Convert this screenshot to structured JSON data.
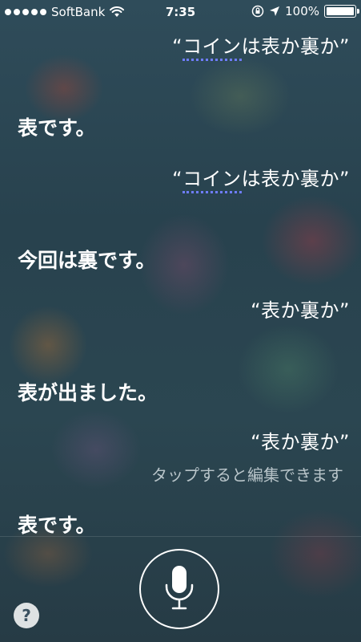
{
  "status_bar": {
    "carrier": "SoftBank",
    "time": "7:35",
    "battery": "100%"
  },
  "conversation": [
    {
      "type": "user",
      "pre": "“",
      "underlined": "コイン",
      "post": "は表か裏か”"
    },
    {
      "type": "siri",
      "text": "表です。"
    },
    {
      "type": "user",
      "pre": "“",
      "underlined": "コイン",
      "post": "は表か裏か”"
    },
    {
      "type": "siri",
      "text": "今回は裏です。"
    },
    {
      "type": "user",
      "pre": "",
      "underlined": "",
      "post": "“表か裏か”"
    },
    {
      "type": "siri",
      "text": "表が出ました。"
    },
    {
      "type": "user",
      "pre": "",
      "underlined": "",
      "post": "“表か裏か”"
    },
    {
      "type": "hint",
      "text": "タップすると編集できます"
    },
    {
      "type": "siri",
      "text": "表です。"
    }
  ],
  "controls": {
    "help_label": "?"
  },
  "icons": {
    "wifi": "wifi-icon",
    "orientation_lock": "orientation-lock-icon",
    "location": "location-arrow-icon",
    "battery": "battery-icon",
    "microphone": "microphone-icon"
  }
}
